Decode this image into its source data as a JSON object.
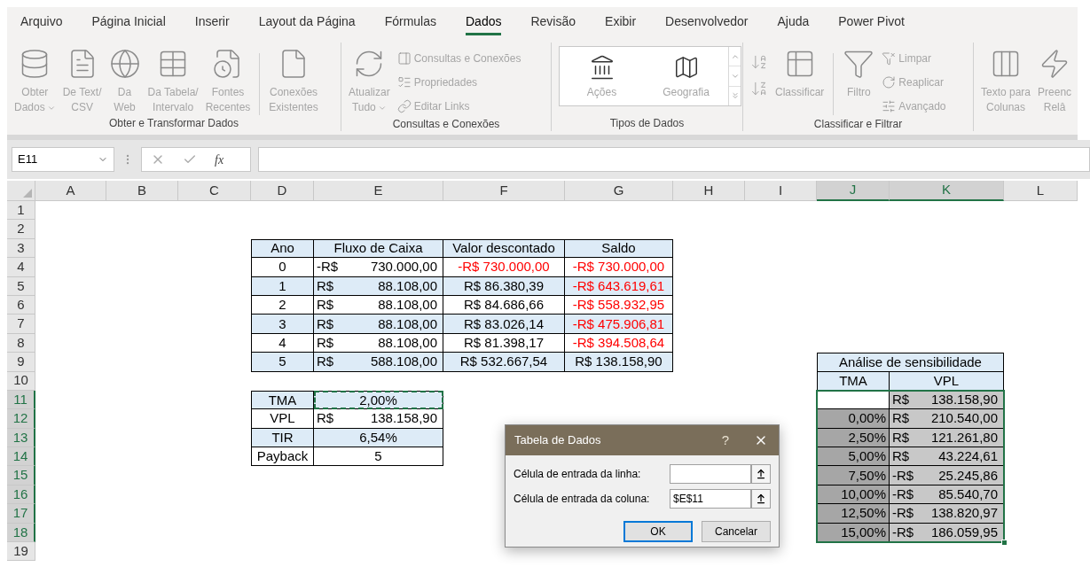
{
  "ribbon": {
    "tabs": [
      {
        "label": "Arquivo",
        "selected": false
      },
      {
        "label": "Página Inicial",
        "selected": false
      },
      {
        "label": "Inserir",
        "selected": false
      },
      {
        "label": "Layout da Página",
        "selected": false
      },
      {
        "label": "Fórmulas",
        "selected": false
      },
      {
        "label": "Dados",
        "selected": true
      },
      {
        "label": "Revisão",
        "selected": false
      },
      {
        "label": "Exibir",
        "selected": false
      },
      {
        "label": "Desenvolvedor",
        "selected": false
      },
      {
        "label": "Ajuda",
        "selected": false
      },
      {
        "label": "Power Pivot",
        "selected": false
      }
    ],
    "groups": [
      {
        "label": "Obter e Transformar Dados",
        "items": [
          {
            "kind": "large",
            "lines": [
              "Obter",
              "Dados"
            ],
            "dropdown": true,
            "disabled": true
          },
          {
            "kind": "large",
            "lines": [
              "De Text/",
              "CSV"
            ],
            "dropdown": false,
            "disabled": true
          },
          {
            "kind": "large",
            "lines": [
              "Da",
              "Web"
            ],
            "dropdown": false,
            "disabled": true
          },
          {
            "kind": "large",
            "lines": [
              "Da Tabela/",
              "Intervalo"
            ],
            "dropdown": false,
            "disabled": true
          },
          {
            "kind": "large",
            "lines": [
              "Fontes",
              "Recentes"
            ],
            "dropdown": false,
            "disabled": true
          },
          {
            "kind": "separator"
          },
          {
            "kind": "large",
            "lines": [
              "Conexões",
              "Existentes"
            ],
            "dropdown": false,
            "disabled": true
          }
        ]
      },
      {
        "label": "Consultas e Conexões",
        "items": [
          {
            "kind": "large",
            "lines": [
              "Atualizar",
              "Tudo"
            ],
            "dropdown": true,
            "disabled": true
          },
          {
            "kind": "small_stack",
            "items": [
              {
                "label": "Consultas e Conexões",
                "disabled": true
              },
              {
                "label": "Propriedades",
                "disabled": true
              },
              {
                "label": "Editar Links",
                "disabled": true
              }
            ]
          }
        ]
      },
      {
        "label": "Tipos de Dados",
        "items": [
          {
            "kind": "gallery",
            "items": [
              {
                "label": "Ações"
              },
              {
                "label": "Geografia"
              }
            ]
          }
        ]
      },
      {
        "label": "Classificar e Filtrar",
        "items": [
          {
            "kind": "sort_pair",
            "disabled": true
          },
          {
            "kind": "large",
            "lines": [
              "Classificar"
            ],
            "dropdown": false,
            "disabled": true
          },
          {
            "kind": "separator"
          },
          {
            "kind": "large",
            "lines": [
              "Filtro"
            ],
            "dropdown": false,
            "disabled": true
          },
          {
            "kind": "small_stack",
            "items": [
              {
                "label": "Limpar",
                "disabled": true
              },
              {
                "label": "Reaplicar",
                "disabled": true
              },
              {
                "label": "Avançado",
                "disabled": true
              }
            ]
          }
        ]
      },
      {
        "items": [
          {
            "kind": "large",
            "lines": [
              "Texto para",
              "Colunas"
            ],
            "dropdown": false,
            "disabled": true
          },
          {
            "kind": "large",
            "lines": [
              "Preenc",
              "Relâ"
            ],
            "dropdown": false,
            "disabled": true
          }
        ]
      }
    ]
  },
  "formula_bar": {
    "name_box": "E11",
    "function_label": "fx"
  },
  "sheet": {
    "columns": [
      {
        "label": "A",
        "selected": false
      },
      {
        "label": "B",
        "selected": false
      },
      {
        "label": "C",
        "selected": false
      },
      {
        "label": "D",
        "selected": false
      },
      {
        "label": "E",
        "selected": false
      },
      {
        "label": "F",
        "selected": false
      },
      {
        "label": "G",
        "selected": false
      },
      {
        "label": "H",
        "selected": false
      },
      {
        "label": "I",
        "selected": false
      },
      {
        "label": "J",
        "selected": true
      },
      {
        "label": "K",
        "selected": true
      },
      {
        "label": "L",
        "selected": false
      }
    ],
    "rows": [
      {
        "label": "1",
        "selected": false
      },
      {
        "label": "2",
        "selected": false
      },
      {
        "label": "3",
        "selected": false
      },
      {
        "label": "4",
        "selected": false
      },
      {
        "label": "5",
        "selected": false
      },
      {
        "label": "6",
        "selected": false
      },
      {
        "label": "7",
        "selected": false
      },
      {
        "label": "8",
        "selected": false
      },
      {
        "label": "9",
        "selected": false
      },
      {
        "label": "10",
        "selected": false
      },
      {
        "label": "11",
        "selected": true
      },
      {
        "label": "12",
        "selected": true
      },
      {
        "label": "13",
        "selected": true
      },
      {
        "label": "14",
        "selected": true
      },
      {
        "label": "15",
        "selected": true
      },
      {
        "label": "16",
        "selected": true
      },
      {
        "label": "17",
        "selected": true
      },
      {
        "label": "18",
        "selected": true
      },
      {
        "label": "19",
        "selected": false
      }
    ]
  },
  "cash_flow": {
    "columns": [
      "Ano",
      "Fluxo de Caixa",
      "Valor descontado",
      "Saldo"
    ],
    "rows": [
      {
        "shaded": false,
        "year": "0",
        "flow_currency": "-R$",
        "flow_amount": "730.000,00",
        "discounted": "-R$ 730.000,00",
        "discounted_negative": true,
        "balance": "-R$ 730.000,00",
        "balance_negative": true
      },
      {
        "shaded": true,
        "year": "1",
        "flow_currency": "R$",
        "flow_amount": "88.108,00",
        "discounted": "R$ 86.380,39",
        "discounted_negative": false,
        "balance": "-R$ 643.619,61",
        "balance_negative": true
      },
      {
        "shaded": false,
        "year": "2",
        "flow_currency": "R$",
        "flow_amount": "88.108,00",
        "discounted": "R$ 84.686,66",
        "discounted_negative": false,
        "balance": "-R$ 558.932,95",
        "balance_negative": true
      },
      {
        "shaded": true,
        "year": "3",
        "flow_currency": "R$",
        "flow_amount": "88.108,00",
        "discounted": "R$ 83.026,14",
        "discounted_negative": false,
        "balance": "-R$ 475.906,81",
        "balance_negative": true
      },
      {
        "shaded": false,
        "year": "4",
        "flow_currency": "R$",
        "flow_amount": "88.108,00",
        "discounted": "R$ 81.398,17",
        "discounted_negative": false,
        "balance": "-R$ 394.508,64",
        "balance_negative": true
      },
      {
        "shaded": true,
        "year": "5",
        "flow_currency": "R$",
        "flow_amount": "588.108,00",
        "discounted": "R$ 532.667,54",
        "discounted_negative": false,
        "balance": "R$ 138.158,90",
        "balance_negative": false
      }
    ]
  },
  "indicators": {
    "rows": [
      {
        "label": "TMA",
        "shaded": true,
        "kind": "plain",
        "value": "2,00%",
        "copy_marquee": true
      },
      {
        "label": "VPL",
        "shaded": false,
        "kind": "currency",
        "currency": "R$",
        "amount": "138.158,90",
        "copy_marquee": false
      },
      {
        "label": "TIR",
        "shaded": true,
        "kind": "plain",
        "value": "6,54%",
        "copy_marquee": false
      },
      {
        "label": "Payback",
        "shaded": false,
        "kind": "plain",
        "value": "5",
        "copy_marquee": false
      }
    ]
  },
  "sensitivity": {
    "title": "Análise de sensibilidade",
    "columns": [
      "TMA",
      "VPL"
    ],
    "rows": [
      {
        "selected": true,
        "active": true,
        "currency": "R$",
        "amount": "138.158,90"
      },
      {
        "selected": true,
        "active": false,
        "rate": "0,00%",
        "currency": "R$",
        "amount": "210.540,00"
      },
      {
        "selected": true,
        "active": false,
        "rate": "2,50%",
        "currency": "R$",
        "amount": "121.261,80"
      },
      {
        "selected": true,
        "active": false,
        "rate": "5,00%",
        "currency": "R$",
        "amount": "43.224,61"
      },
      {
        "selected": true,
        "active": false,
        "rate": "7,50%",
        "currency": "-R$",
        "amount": "25.245,86"
      },
      {
        "selected": true,
        "active": false,
        "rate": "10,00%",
        "currency": "-R$",
        "amount": "85.540,70"
      },
      {
        "selected": true,
        "active": false,
        "rate": "12,50%",
        "currency": "-R$",
        "amount": "138.820,97"
      },
      {
        "selected": true,
        "active": false,
        "rate": "15,00%",
        "currency": "-R$",
        "amount": "186.059,95"
      }
    ]
  },
  "dialog": {
    "title": "Tabela de Dados",
    "help": "?",
    "fields": [
      {
        "label": "Célula de entrada da linha:"
      },
      {
        "label": "Célula de entrada da coluna:",
        "value": "$E$11"
      }
    ],
    "buttons": [
      {
        "label": "OK",
        "default": true
      },
      {
        "label": "Cancelar",
        "default": false
      }
    ]
  }
}
